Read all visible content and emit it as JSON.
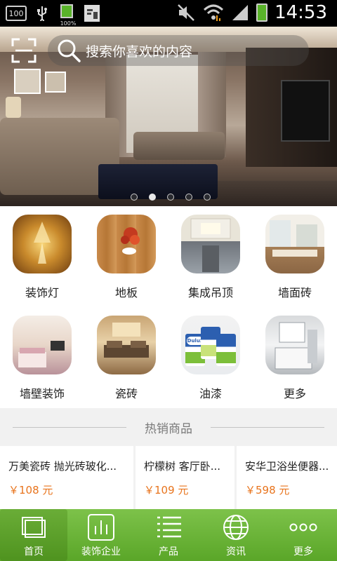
{
  "status_bar": {
    "box_label": "100",
    "battery_small_label": "100%",
    "time": "14:53"
  },
  "search": {
    "placeholder": "搜索你喜欢的内容"
  },
  "banner": {
    "page_count": 5,
    "active_index": 1
  },
  "categories": [
    {
      "label": "装饰灯",
      "icon": "lamp-icon"
    },
    {
      "label": "地板",
      "icon": "floor-icon"
    },
    {
      "label": "集成吊顶",
      "icon": "ceiling-icon"
    },
    {
      "label": "墙面砖",
      "icon": "wall-tile-icon"
    },
    {
      "label": "墙壁装饰",
      "icon": "wall-decor-icon"
    },
    {
      "label": "瓷砖",
      "icon": "ceramic-tile-icon"
    },
    {
      "label": "油漆",
      "icon": "paint-icon"
    },
    {
      "label": "更多",
      "icon": "more-icon"
    }
  ],
  "paint_brand": "Dulux",
  "hot_section": {
    "title": "热销商品"
  },
  "products": [
    {
      "name": "万美瓷砖 抛光砖玻化...",
      "price": "￥108 元"
    },
    {
      "name": "柠檬树 客厅卧...",
      "price": "￥109 元"
    },
    {
      "name": "安华卫浴坐便器...",
      "price": "￥598 元"
    }
  ],
  "bottom_nav": [
    {
      "label": "首页",
      "icon": "home-icon",
      "active": true
    },
    {
      "label": "装饰企业",
      "icon": "enterprise-icon",
      "active": false
    },
    {
      "label": "产品",
      "icon": "product-list-icon",
      "active": false
    },
    {
      "label": "资讯",
      "icon": "globe-icon",
      "active": false
    },
    {
      "label": "更多",
      "icon": "more-dots-icon",
      "active": false
    }
  ],
  "colors": {
    "accent_green": "#6ab33a",
    "price_orange": "#e8741d",
    "separator_bg": "#f1f1f1"
  }
}
